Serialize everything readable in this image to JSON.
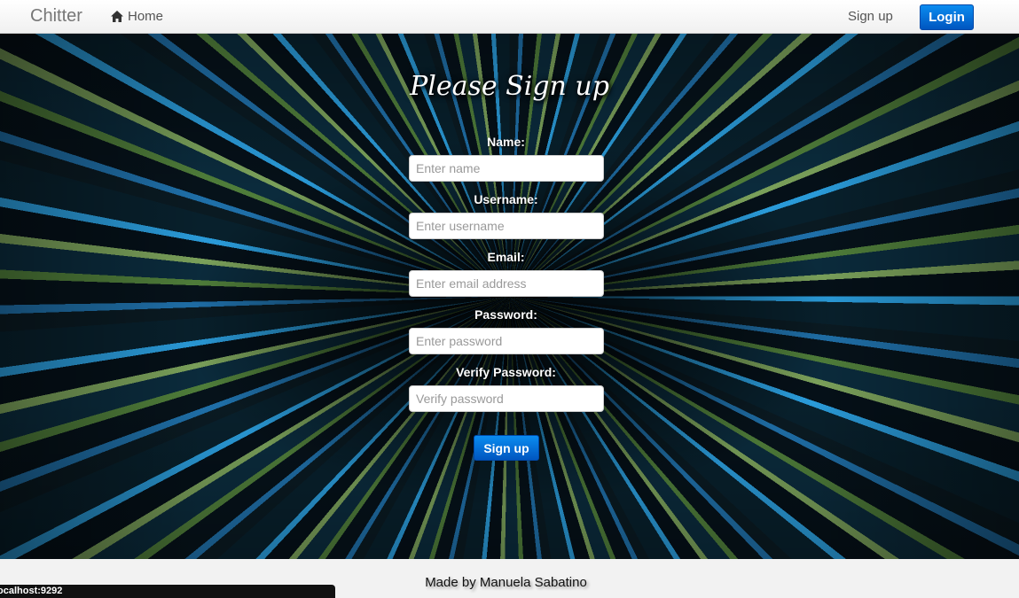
{
  "navbar": {
    "brand": "Chitter",
    "home_label": "Home",
    "home_icon": "home-icon",
    "signup_label": "Sign up",
    "login_label": "Login"
  },
  "form": {
    "title": "Please Sign up",
    "fields": [
      {
        "label": "Name:",
        "placeholder": "Enter name",
        "value": ""
      },
      {
        "label": "Username:",
        "placeholder": "Enter username",
        "value": ""
      },
      {
        "label": "Email:",
        "placeholder": "Enter email address",
        "value": ""
      },
      {
        "label": "Password:",
        "placeholder": "Enter password",
        "value": ""
      },
      {
        "label": "Verify Password:",
        "placeholder": "Verify password",
        "value": ""
      }
    ],
    "submit_label": "Sign up"
  },
  "footer": {
    "text": "Made by Manuela Sabatino"
  },
  "status_bar": {
    "text": "ocalhost:9292"
  },
  "colors": {
    "accent": "#0066cc",
    "navbar_bg": "#f7f7f7",
    "footer_bg": "#f2f2f2"
  }
}
